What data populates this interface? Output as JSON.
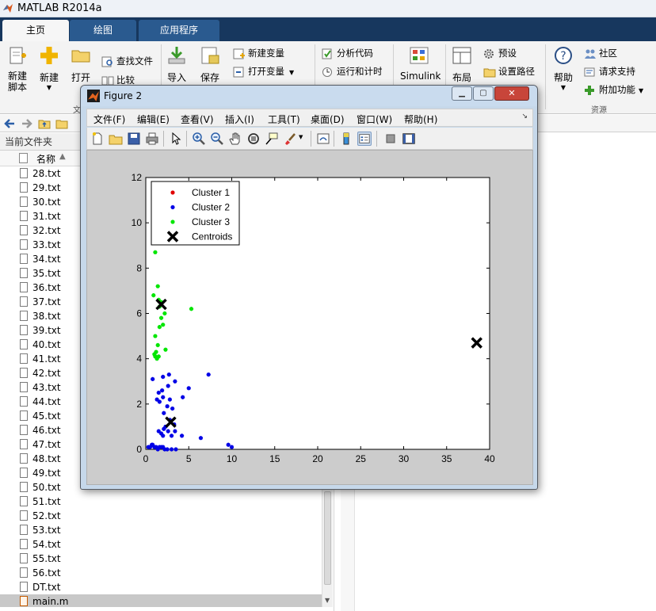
{
  "app": {
    "title": "MATLAB R2014a"
  },
  "ribbon": {
    "tabs": [
      "主页",
      "绘图",
      "应用程序"
    ],
    "buttons": {
      "new_script": "新建\n脚本",
      "new": "新建",
      "open": "打开",
      "find_files": "查找文件",
      "compare": "比较",
      "import": "导入",
      "save": "保存",
      "new_variable": "新建变量",
      "open_variable": "打开变量",
      "analyze_code": "分析代码",
      "run_and_time": "运行和计时",
      "simulink": "Simulink",
      "layout": "布局",
      "preferences": "预设",
      "set_path": "设置路径",
      "help": "帮助",
      "community": "社区",
      "request_support": "请求支持",
      "add_ons": "附加功能"
    },
    "group_labels": {
      "file": "文",
      "resources": "资源"
    }
  },
  "current_folder": {
    "title": "当前文件夹",
    "column_name": "名称",
    "files": [
      "28.txt",
      "29.txt",
      "30.txt",
      "31.txt",
      "32.txt",
      "33.txt",
      "34.txt",
      "35.txt",
      "36.txt",
      "37.txt",
      "38.txt",
      "39.txt",
      "40.txt",
      "41.txt",
      "42.txt",
      "43.txt",
      "44.txt",
      "45.txt",
      "46.txt",
      "47.txt",
      "48.txt",
      "49.txt",
      "50.txt",
      "51.txt",
      "52.txt",
      "53.txt",
      "54.txt",
      "55.txt",
      "56.txt",
      "DT.txt",
      "main.m"
    ],
    "selected": "main.m"
  },
  "figure": {
    "title": "Figure 2",
    "menu": [
      "文件(F)",
      "编辑(E)",
      "查看(V)",
      "插入(I)",
      "工具(T)",
      "桌面(D)",
      "窗口(W)",
      "帮助(H)"
    ],
    "toolbar_icons": [
      "new-figure-icon",
      "open-file-icon",
      "save-figure-icon",
      "print-icon",
      "edit-plot-arrow-icon",
      "zoom-in-icon",
      "zoom-out-icon",
      "pan-hand-icon",
      "rotate-3d-icon",
      "data-cursor-icon",
      "brush-icon",
      "link-plot-icon",
      "colorbar-icon",
      "legend-icon",
      "hide-plot-tools-icon",
      "show-plot-tools-icon"
    ]
  },
  "chart_data": {
    "type": "scatter",
    "title": "",
    "xlabel": "",
    "ylabel": "",
    "xlim": [
      0,
      40
    ],
    "ylim": [
      0,
      12
    ],
    "xticks": [
      0,
      5,
      10,
      15,
      20,
      25,
      30,
      35,
      40
    ],
    "yticks": [
      0,
      2,
      4,
      6,
      8,
      10,
      12
    ],
    "grid": false,
    "legend_position": "top-left",
    "series": [
      {
        "name": "Cluster 1",
        "color": "#e00000",
        "marker": "*",
        "points": []
      },
      {
        "name": "Cluster 2",
        "color": "#0000e6",
        "marker": "*",
        "points": [
          [
            0.3,
            0.1
          ],
          [
            0.5,
            0.1
          ],
          [
            0.7,
            0.2
          ],
          [
            0.8,
            0.2
          ],
          [
            1.0,
            0.1
          ],
          [
            1.2,
            0.1
          ],
          [
            1.4,
            0.0
          ],
          [
            1.6,
            0.1
          ],
          [
            1.8,
            0.1
          ],
          [
            2.0,
            0.1
          ],
          [
            2.2,
            0.0
          ],
          [
            2.5,
            0.0
          ],
          [
            3.0,
            0.0
          ],
          [
            3.5,
            0.0
          ],
          [
            1.5,
            0.8
          ],
          [
            1.8,
            0.7
          ],
          [
            2.0,
            0.6
          ],
          [
            2.1,
            0.9
          ],
          [
            2.3,
            1.0
          ],
          [
            2.6,
            0.8
          ],
          [
            3.0,
            0.6
          ],
          [
            3.4,
            0.8
          ],
          [
            4.2,
            0.6
          ],
          [
            3.3,
            1.1
          ],
          [
            2.8,
            1.3
          ],
          [
            2.1,
            1.6
          ],
          [
            2.5,
            1.9
          ],
          [
            1.3,
            2.2
          ],
          [
            1.6,
            2.1
          ],
          [
            2.0,
            2.3
          ],
          [
            2.8,
            2.2
          ],
          [
            3.1,
            1.8
          ],
          [
            4.3,
            2.3
          ],
          [
            5.0,
            2.7
          ],
          [
            1.5,
            2.5
          ],
          [
            1.9,
            2.6
          ],
          [
            2.6,
            2.8
          ],
          [
            3.4,
            3.0
          ],
          [
            0.8,
            3.1
          ],
          [
            2.0,
            3.2
          ],
          [
            2.7,
            3.3
          ],
          [
            7.3,
            3.3
          ],
          [
            6.4,
            0.5
          ],
          [
            9.6,
            0.2
          ],
          [
            10.0,
            0.1
          ]
        ]
      },
      {
        "name": "Cluster 3",
        "color": "#00e600",
        "marker": "*",
        "points": [
          [
            1.0,
            4.2
          ],
          [
            1.1,
            4.1
          ],
          [
            1.3,
            4.0
          ],
          [
            1.5,
            4.1
          ],
          [
            1.2,
            4.3
          ],
          [
            1.1,
            5.0
          ],
          [
            1.4,
            4.6
          ],
          [
            2.3,
            4.4
          ],
          [
            1.6,
            5.4
          ],
          [
            1.8,
            5.8
          ],
          [
            2.0,
            5.5
          ],
          [
            2.2,
            6.0
          ],
          [
            1.6,
            6.3
          ],
          [
            1.8,
            6.5
          ],
          [
            1.5,
            6.6
          ],
          [
            0.9,
            6.8
          ],
          [
            1.4,
            7.2
          ],
          [
            5.3,
            6.2
          ],
          [
            1.1,
            8.7
          ]
        ]
      },
      {
        "name": "Centroids",
        "color": "#000000",
        "marker": "x",
        "points": [
          [
            1.8,
            6.4
          ],
          [
            2.9,
            1.2
          ],
          [
            38.5,
            4.7
          ]
        ]
      }
    ]
  }
}
